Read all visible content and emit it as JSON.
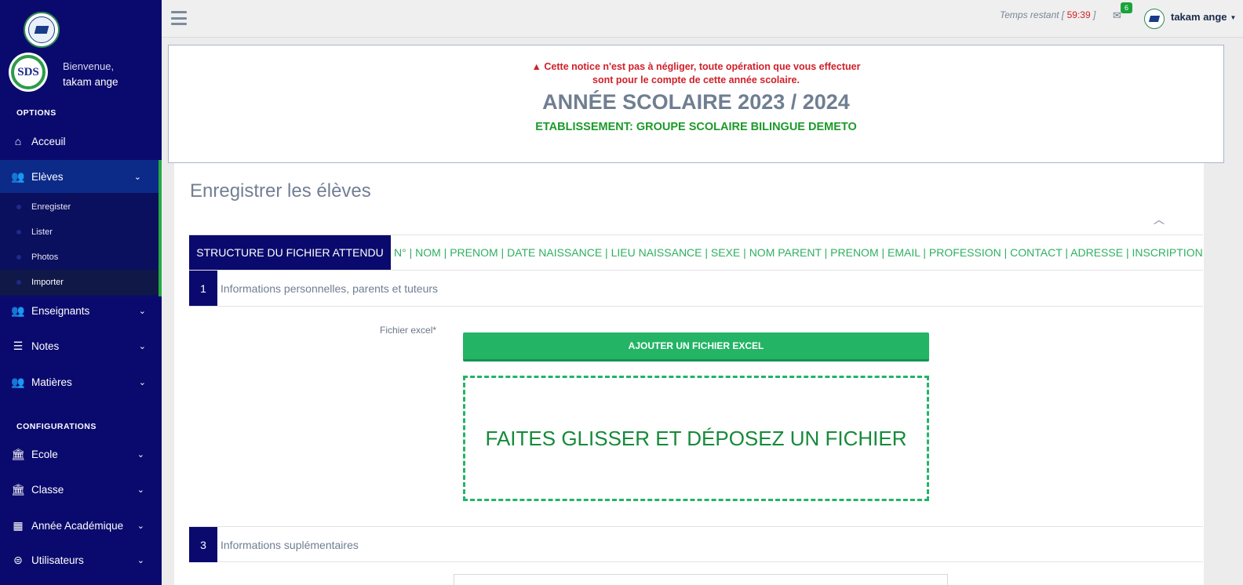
{
  "sidebar": {
    "welcome": "Bienvenue,",
    "username": "takam ange",
    "section_options": "OPTIONS",
    "section_config": "CONFIGURATIONS",
    "items": {
      "accueil": "Acceuil",
      "eleves": "Elèves",
      "enseignants": "Enseignants",
      "notes": "Notes",
      "matieres": "Matières",
      "ecole": "Ecole",
      "classe": "Classe",
      "annee": "Année Académique",
      "utilisateurs": "Utilisateurs"
    },
    "submenu": {
      "enregister": "Enregister",
      "lister": "Lister",
      "photos": "Photos",
      "importer": "Importer"
    },
    "avatar_text": "SDS"
  },
  "topbar": {
    "timer_label": "Temps restant [ ",
    "timer_value": "59:39",
    "timer_end": " ]",
    "mail_badge": "6",
    "user": "takam ange"
  },
  "notice": {
    "warning_line1": "Cette notice n'est pas à négliger, toute opération que vous effectuer",
    "warning_line2": "sont pour le compte de cette année scolaire.",
    "year": "ANNÉE SCOLAIRE 2023 / 2024",
    "etablissement": "ETABLISSEMENT: GROUPE SCOLAIRE BILINGUE DEMETO"
  },
  "main": {
    "title": "Enregistrer les élèves",
    "structure_label": "STRUCTURE DU FICHIER ATTENDU",
    "structure_cols": "N° | NOM | PRENOM | DATE NAISSANCE | LIEU NAISSANCE | SEXE | NOM PARENT | PRENOM | EMAIL | PROFESSION | CONTACT | ADRESSE | INSCRIPTION",
    "step1_num": "1",
    "step1_text": "Informations personnelles, parents et tuteurs",
    "file_label": "Fichier excel*",
    "add_button": "AJOUTER UN FICHIER EXCEL",
    "dropzone": "FAITES GLISSER ET DÉPOSEZ UN FICHIER",
    "step3_num": "3",
    "step3_text": "Informations suplémentaires"
  },
  "colors": {
    "sidebar_bg": "#0a0a6e",
    "accent_green": "#23b466",
    "warning_red": "#d0202a"
  }
}
